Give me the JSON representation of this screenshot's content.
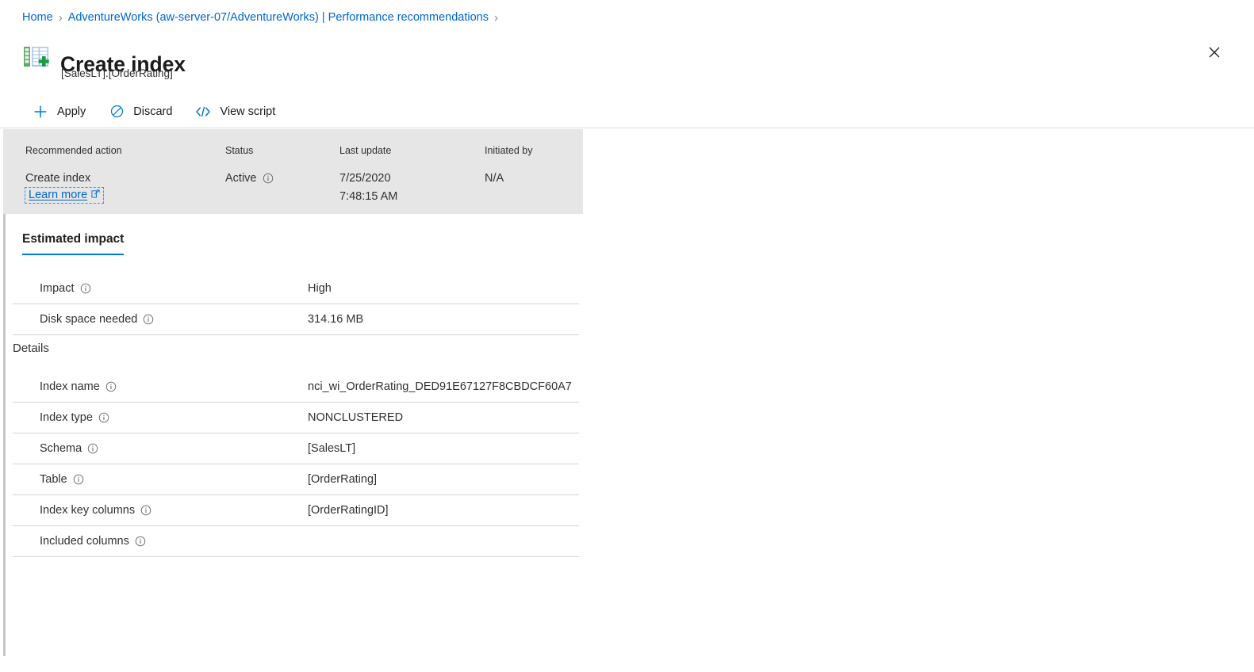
{
  "breadcrumb": {
    "items": [
      {
        "label": "Home"
      },
      {
        "label": "AdventureWorks (aw-server-07/AdventureWorks) | Performance recommendations"
      }
    ],
    "separator": "›"
  },
  "header": {
    "title": "Create index",
    "subtitle": "[SalesLT].[OrderRating]",
    "icon": "create-index-table-icon",
    "close_label": "✕"
  },
  "toolbar": {
    "apply_label": "Apply",
    "discard_label": "Discard",
    "view_script_label": "View script",
    "apply_icon": "plus-icon",
    "discard_icon": "block-circle-icon",
    "view_script_icon": "code-brackets-icon"
  },
  "summary": {
    "headers": {
      "recommended_action": "Recommended action",
      "status": "Status",
      "last_update": "Last update",
      "initiated_by": "Initiated by"
    },
    "values": {
      "recommended_action": "Create index",
      "learn_more": "Learn more",
      "status": "Active",
      "last_update_date": "7/25/2020",
      "last_update_time": "7:48:15 AM",
      "initiated_by": "N/A"
    }
  },
  "tabs": [
    {
      "label": "Estimated impact",
      "active": true
    }
  ],
  "estimated_impact": {
    "rows": [
      {
        "label": "Impact",
        "value": "High"
      },
      {
        "label": "Disk space needed",
        "value": "314.16 MB"
      }
    ]
  },
  "details": {
    "section_label": "Details",
    "rows": [
      {
        "label": "Index name",
        "value": "nci_wi_OrderRating_DED91E67127F8CBDCF60A7"
      },
      {
        "label": "Index type",
        "value": "NONCLUSTERED"
      },
      {
        "label": "Schema",
        "value": "[SalesLT]"
      },
      {
        "label": "Table",
        "value": "[OrderRating]"
      },
      {
        "label": "Index key columns",
        "value": "[OrderRatingID]"
      },
      {
        "label": "Included columns",
        "value": ""
      }
    ]
  },
  "colors": {
    "link": "#0066cc",
    "accent": "#0078d4",
    "panel_bg": "#e6e6e6",
    "icon_green": "#107c10",
    "icon_blue": "#5b9bd5",
    "text": "#323130"
  }
}
